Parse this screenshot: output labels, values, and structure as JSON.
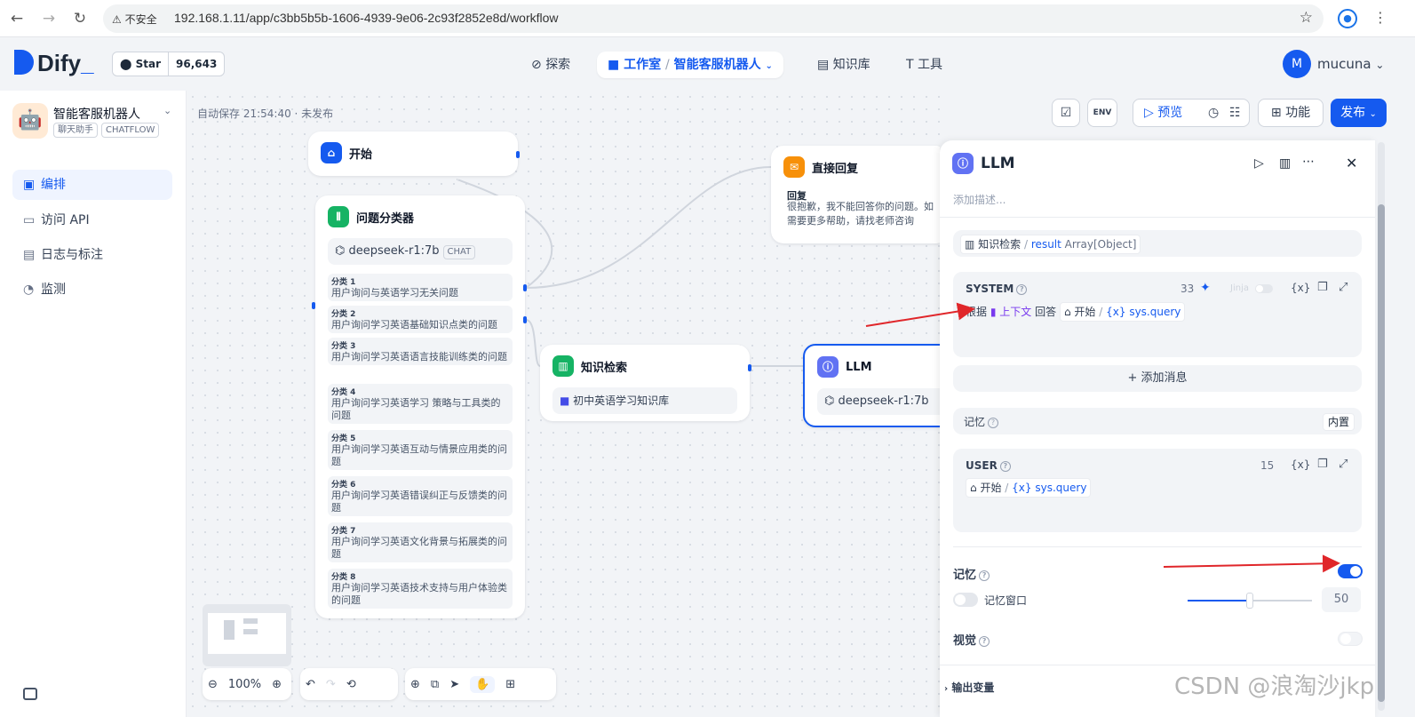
{
  "browser": {
    "secure_label": "不安全",
    "url": "192.168.1.11/app/c3bb5b5b-1606-4939-9e06-2c93f2852e8d/workflow"
  },
  "header": {
    "logo": "Dify",
    "github_star": "Star",
    "github_count": "96,643",
    "nav_explore": "探索",
    "nav_studio": "工作室",
    "nav_app": "智能客服机器人",
    "nav_knowledge": "知识库",
    "nav_tools": "工具",
    "avatar_letter": "M",
    "username": "mucuna"
  },
  "sidebar": {
    "app_name": "智能客服机器人",
    "tag1": "聊天助手",
    "tag2": "CHATFLOW",
    "items": [
      {
        "label": "编排"
      },
      {
        "label": "访问 API"
      },
      {
        "label": "日志与标注"
      },
      {
        "label": "监测"
      }
    ]
  },
  "canvas": {
    "autosave": "自动保存 21:54:40 · 未发布",
    "start_title": "开始",
    "reply_title": "直接回复",
    "reply_label": "回复",
    "reply_text1": "很抱歉，我不能回答你的问题。如",
    "reply_text2": "需要更多帮助，请找老师咨询",
    "classifier_title": "问题分类器",
    "classifier_model": "deepseek-r1:7b",
    "model_tag": "CHAT",
    "classes": [
      {
        "head": "分类 1",
        "text": "用户询问与英语学习无关问题"
      },
      {
        "head": "分类 2",
        "text": "用户询问学习英语基础知识点类的问题"
      },
      {
        "head": "分类 3",
        "text": "用户询问学习英语语言技能训练类的问题"
      },
      {
        "head": "分类 4",
        "text": "用户询问学习英语学习 策略与工具类的问题"
      },
      {
        "head": "分类 5",
        "text": "用户询问学习英语互动与情景应用类的问题"
      },
      {
        "head": "分类 6",
        "text": "用户询问学习英语错误纠正与反馈类的问题"
      },
      {
        "head": "分类 7",
        "text": "用户询问学习英语文化背景与拓展类的问题"
      },
      {
        "head": "分类 8",
        "text": "用户询问学习英语技术支持与用户体验类的问题"
      }
    ],
    "knowledge_title": "知识检索",
    "knowledge_base": "初中英语学习知识库",
    "llm_title": "LLM",
    "llm_model": "deepseek-r1:7b",
    "zoom": "100%"
  },
  "toolbar_right": {
    "env": "ENV",
    "preview": "预览",
    "features": "功能",
    "publish": "发布"
  },
  "panel": {
    "title": "LLM",
    "desc_placeholder": "添加描述...",
    "context_source": "知识检索",
    "context_var": "result",
    "context_type": "Array[Object]",
    "system_label": "SYSTEM",
    "system_count": "33",
    "jinja": "Jinja",
    "var_icon": "{x}",
    "sys_text1": "根据",
    "sys_ctx": "上下文",
    "sys_text2": "回答",
    "sys_start": "开始",
    "sys_query": "sys.query",
    "add_message": "添加消息",
    "memory_label": "记忆",
    "builtin": "内置",
    "user_label": "USER",
    "user_count": "15",
    "user_start": "开始",
    "user_query": "sys.query",
    "memory_toggle_label": "记忆",
    "memory_window": "记忆窗口",
    "memory_window_value": "50",
    "memory_window_fraction": 0.5,
    "vision_label": "视觉",
    "output_vars": "输出变量"
  },
  "watermark": "CSDN @浪淘沙jkp",
  "colors": {
    "accent": "#155aef",
    "arrow": "#e0262a"
  }
}
